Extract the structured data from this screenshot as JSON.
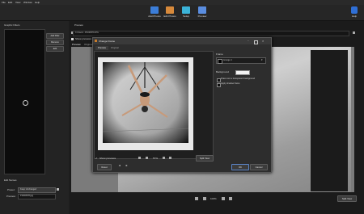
{
  "menu": [
    "File",
    "Edit",
    "View",
    "Window",
    "Help"
  ],
  "toolbar": {
    "items": [
      {
        "label": "Add Photos",
        "icon": "add-photos-icon",
        "color": "#3b7dd8"
      },
      {
        "label": "Edit Photos",
        "icon": "edit-photos-icon",
        "color": "#d88a3b"
      },
      {
        "label": "Setup",
        "icon": "setup-icon",
        "color": "#3bb3d8"
      },
      {
        "label": "Preview",
        "icon": "preview-icon",
        "color": "#5a8de0"
      }
    ],
    "help_label": "Help",
    "help_color": "#2f6fd6"
  },
  "left": {
    "title": "Graphic Filters",
    "add_filter": "Add Filter",
    "remove": "Remove",
    "edit": "Edit",
    "edit_names": "Edit Names",
    "preset_label": "Preset:",
    "preset_value": "Keep Unchanged",
    "preview_label": "Preview:",
    "preview_value": "P1000578.jpg"
  },
  "main": {
    "section_label": "Preview",
    "path": "C:\\Users\\...\\P1000578.JPG",
    "show_previews": "Show previews",
    "tabs": [
      "Preview",
      "Original"
    ],
    "split_view": "Split View",
    "zoom": "100%"
  },
  "dialog": {
    "title": "Change Frame",
    "tabs": [
      "Preview",
      "Original"
    ],
    "frame_label": "Frame",
    "frame_value": "Grunge 1",
    "background_label": "Background",
    "background_color": "#f2f2f2",
    "check1": "Draw over a transparent background",
    "check2": "Apply shadow frame",
    "show_previews": "Show previews",
    "zoom": "57%",
    "split_view": "Split View",
    "reset": "Reset",
    "ok": "OK",
    "cancel": "Cancel"
  }
}
